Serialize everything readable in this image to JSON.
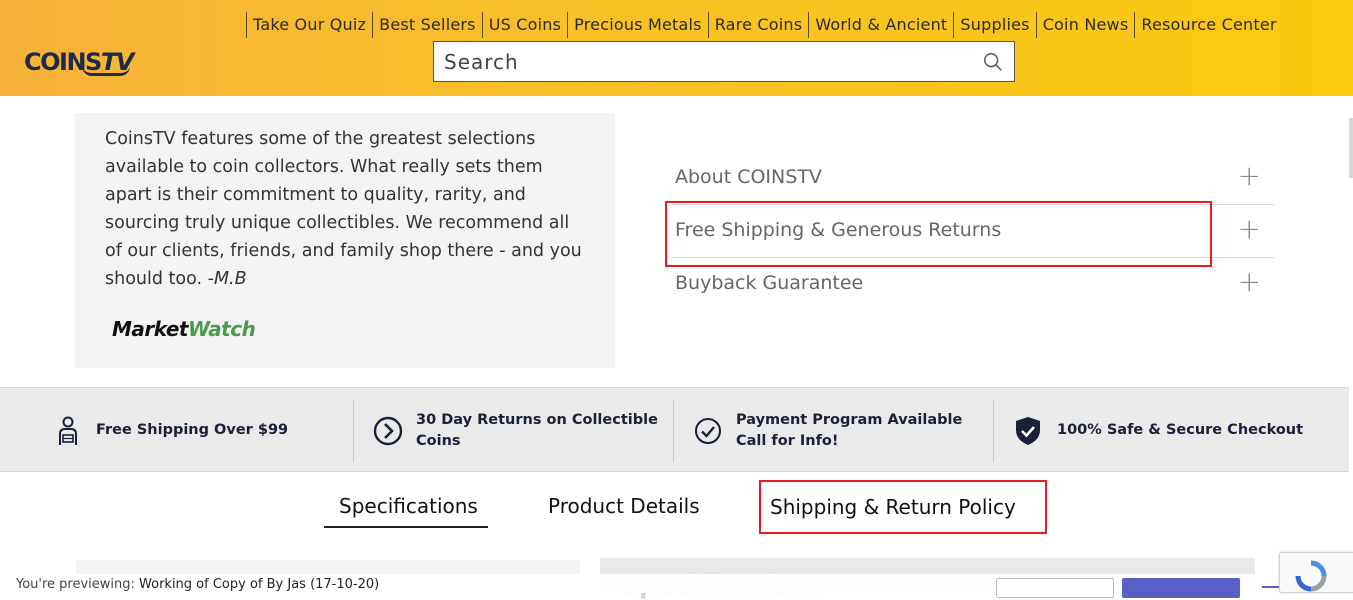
{
  "header": {
    "logo_text": "COINS",
    "logo_text_tv": "TV",
    "nav": [
      "Take Our Quiz",
      "Best Sellers",
      "US Coins",
      "Precious Metals",
      "Rare Coins",
      "World & Ancient",
      "Supplies",
      "Coin News",
      "Resource Center"
    ],
    "search_placeholder": "Search"
  },
  "testimonial": {
    "quote": "CoinsTV features some of the greatest selections available to coin collectors. What really sets them apart is their commitment to quality, rarity, and sourcing truly unique collectibles. We recommend all of our clients, friends, and family shop there - and you should too. ",
    "author": "-M.B",
    "source_logo_a": "Market",
    "source_logo_b": "Watch"
  },
  "accordion": [
    {
      "label": "About COINSTV",
      "icon": "plus-icon"
    },
    {
      "label": "Free Shipping & Generous Returns",
      "icon": "plus-icon"
    },
    {
      "label": "Buyback Guarantee",
      "icon": "plus-icon"
    }
  ],
  "benefits": [
    {
      "icon": "delivery-person-icon",
      "text": "Free Shipping Over $99"
    },
    {
      "icon": "circle-chevron-right-icon",
      "text_line1": "30 Day Returns on Collectible",
      "text_line2": "Coins"
    },
    {
      "icon": "circle-check-icon",
      "text_line1": "Payment Program Available",
      "text_line2": "Call for Info!"
    },
    {
      "icon": "shield-check-icon",
      "text": "100% Safe & Secure Checkout"
    }
  ],
  "tabs": [
    "Specifications",
    "Product Details",
    "Shipping & Return Policy"
  ],
  "active_tab": "Specifications",
  "bottom": {
    "specs_heading": "Specifications",
    "preview_prefix": "You're previewing: ",
    "preview_name": "Working of Copy of By Jas (17-10-20)"
  },
  "colors": {
    "header_gradient_start": "#f7b23a",
    "header_gradient_end": "#fbc90f",
    "brand_navy": "#1d2a4a",
    "highlight_red": "#e01e26",
    "marketwatch_green": "#4a9a4b",
    "preview_button": "#5a5fc7"
  }
}
